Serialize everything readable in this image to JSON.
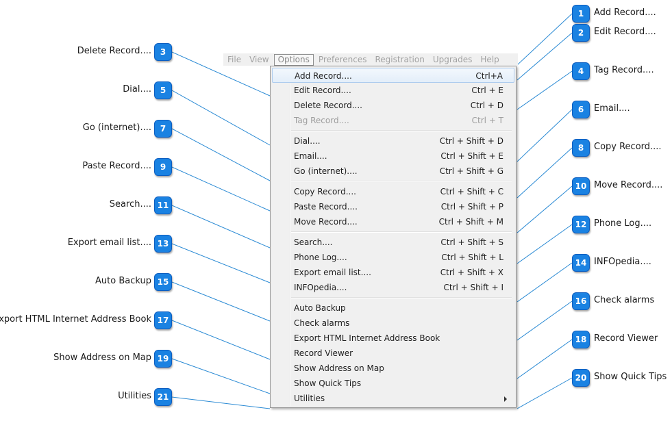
{
  "menubar": {
    "items": [
      "File",
      "View",
      "Options",
      "Preferences",
      "Registration",
      "Upgrades",
      "Help"
    ],
    "active": "Options"
  },
  "menu": {
    "groups": [
      [
        {
          "label": "Add Record....",
          "shortcut": "Ctrl+A",
          "highlighted": true
        },
        {
          "label": "Edit Record....",
          "shortcut": "Ctrl + E"
        },
        {
          "label": "Delete Record....",
          "shortcut": "Ctrl + D"
        },
        {
          "label": "Tag Record....",
          "shortcut": "Ctrl + T",
          "disabled": true
        }
      ],
      [
        {
          "label": "Dial....",
          "shortcut": "Ctrl + Shift + D"
        },
        {
          "label": "Email....",
          "shortcut": "Ctrl + Shift + E"
        },
        {
          "label": "Go (internet)....",
          "shortcut": "Ctrl + Shift + G"
        }
      ],
      [
        {
          "label": "Copy Record....",
          "shortcut": "Ctrl + Shift + C"
        },
        {
          "label": "Paste Record....",
          "shortcut": "Ctrl + Shift + P"
        },
        {
          "label": "Move Record....",
          "shortcut": "Ctrl + Shift + M"
        }
      ],
      [
        {
          "label": "Search....",
          "shortcut": "Ctrl + Shift + S"
        },
        {
          "label": "Phone Log....",
          "shortcut": "Ctrl + Shift + L"
        },
        {
          "label": "Export email list....",
          "shortcut": "Ctrl + Shift + X"
        },
        {
          "label": "INFOpedia....",
          "shortcut": "Ctrl + Shift + I"
        }
      ],
      [
        {
          "label": "Auto Backup",
          "shortcut": ""
        },
        {
          "label": "Check alarms",
          "shortcut": ""
        },
        {
          "label": "Export HTML Internet Address Book",
          "shortcut": ""
        },
        {
          "label": "Record Viewer",
          "shortcut": ""
        },
        {
          "label": "Show Address on Map",
          "shortcut": ""
        },
        {
          "label": "Show Quick Tips",
          "shortcut": ""
        },
        {
          "label": "Utilities",
          "shortcut": "",
          "submenu": true
        }
      ]
    ]
  },
  "callouts": [
    {
      "num": "1",
      "text": "Add Record....",
      "side": "right"
    },
    {
      "num": "2",
      "text": "Edit Record....",
      "side": "right"
    },
    {
      "num": "3",
      "text": "Delete Record....",
      "side": "left"
    },
    {
      "num": "4",
      "text": "Tag Record....",
      "side": "right"
    },
    {
      "num": "5",
      "text": "Dial....",
      "side": "left"
    },
    {
      "num": "6",
      "text": "Email....",
      "side": "right"
    },
    {
      "num": "7",
      "text": "Go (internet)....",
      "side": "left"
    },
    {
      "num": "8",
      "text": "Copy Record....",
      "side": "right"
    },
    {
      "num": "9",
      "text": "Paste Record....",
      "side": "left"
    },
    {
      "num": "10",
      "text": "Move Record....",
      "side": "right"
    },
    {
      "num": "11",
      "text": "Search....",
      "side": "left"
    },
    {
      "num": "12",
      "text": "Phone Log....",
      "side": "right"
    },
    {
      "num": "13",
      "text": "Export email list....",
      "side": "left"
    },
    {
      "num": "14",
      "text": "INFOpedia....",
      "side": "right"
    },
    {
      "num": "15",
      "text": "Auto Backup",
      "side": "left"
    },
    {
      "num": "16",
      "text": "Check alarms",
      "side": "right"
    },
    {
      "num": "17",
      "text": "Export HTML Internet Address Book",
      "side": "left"
    },
    {
      "num": "18",
      "text": "Record Viewer",
      "side": "right"
    },
    {
      "num": "19",
      "text": "Show Address on Map",
      "side": "left"
    },
    {
      "num": "20",
      "text": "Show Quick Tips",
      "side": "right"
    },
    {
      "num": "21",
      "text": "Utilities",
      "side": "left"
    }
  ],
  "colors": {
    "badge": "#1a82e2",
    "leader_line": "#2a8ad4",
    "highlight_border": "#aeccee"
  }
}
